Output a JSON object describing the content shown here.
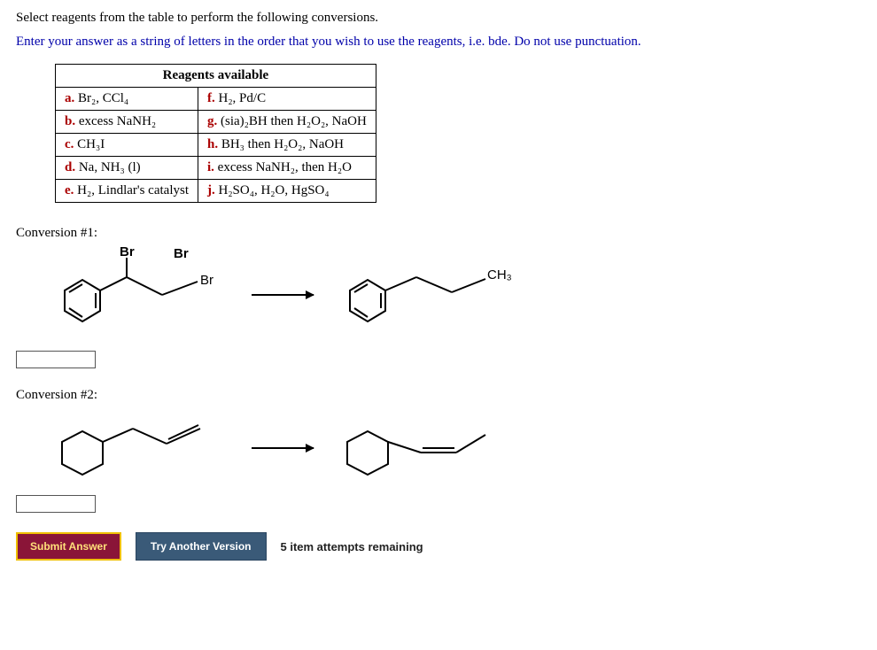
{
  "instructions": {
    "line1": "Select reagents from the table to perform the following conversions.",
    "line2": "Enter your answer as a string of letters in the order that you wish to use the reagents, i.e. bde. Do not use punctuation."
  },
  "table": {
    "heading": "Reagents available",
    "rows": [
      {
        "left_letter": "a.",
        "left_text": "Br₂, CCl₄",
        "right_letter": "f.",
        "right_text": "H₂, Pd/C"
      },
      {
        "left_letter": "b.",
        "left_text": "excess NaNH₂",
        "right_letter": "g.",
        "right_text": "(sia)₂BH then H₂O₂, NaOH"
      },
      {
        "left_letter": "c.",
        "left_text": "CH₃I",
        "right_letter": "h.",
        "right_text": "BH₃ then H₂O₂, NaOH"
      },
      {
        "left_letter": "d.",
        "left_text": "Na, NH₃ (l)",
        "right_letter": "i.",
        "right_text": "excess NaNH₂, then H₂O"
      },
      {
        "left_letter": "e.",
        "left_text": "H₂, Lindlar's catalyst",
        "right_letter": "j.",
        "right_text": "H₂SO₄, H₂O, HgSO₄"
      }
    ]
  },
  "conversions": {
    "c1_label": "Conversion #1:",
    "c2_label": "Conversion #2:",
    "c1_value": "",
    "c2_value": "",
    "c1_struct": {
      "start_labels": {
        "Br_top": "Br",
        "Br_right": "Br"
      },
      "product_labels": {
        "CH3": "CH₃"
      }
    }
  },
  "buttons": {
    "submit": "Submit Answer",
    "try": "Try Another Version"
  },
  "status": {
    "attempts": "5 item attempts remaining"
  }
}
